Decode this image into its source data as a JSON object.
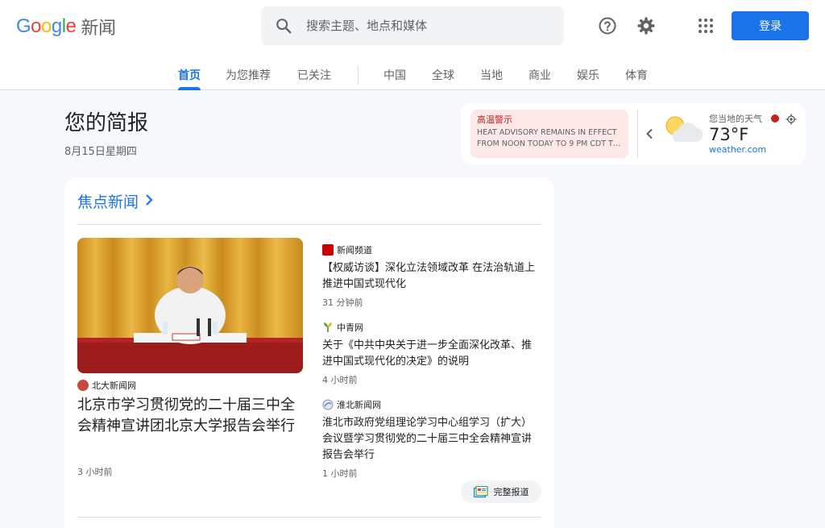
{
  "header": {
    "logo_letters": [
      "G",
      "o",
      "o",
      "g",
      "l",
      "e"
    ],
    "product_name": "新闻",
    "search_placeholder": "搜索主题、地点和媒体",
    "login_label": "登录"
  },
  "tabs": [
    {
      "label": "首页",
      "active": true
    },
    {
      "label": "为您推荐",
      "active": false
    },
    {
      "label": "已关注",
      "active": false
    },
    {
      "label": "中国",
      "active": false
    },
    {
      "label": "全球",
      "active": false
    },
    {
      "label": "当地",
      "active": false
    },
    {
      "label": "商业",
      "active": false
    },
    {
      "label": "娱乐",
      "active": false
    },
    {
      "label": "体育",
      "active": false
    }
  ],
  "briefing": {
    "title": "您的简报",
    "date": "8月15日星期四"
  },
  "weather": {
    "alert_title": "高温警示",
    "alert_line1": "HEAT ADVISORY REMAINS IN EFFECT",
    "alert_line2": "FROM NOON TODAY TO 9 PM CDT THI...",
    "location_label": "您当地的天气",
    "temperature": "73°F",
    "source": "weather.com"
  },
  "top_stories": {
    "heading": "焦点新闻",
    "full_coverage_label": "完整报道",
    "hero": {
      "source": "北大新闻网",
      "title": "北京市学习贯彻党的二十届三中全会精神宣讲团北京大学报告会举行",
      "time": "3 小时前"
    },
    "stories": [
      {
        "source": "新闻频道",
        "title": "【权威访谈】深化立法领域改革 在法治轨道上推进中国式现代化",
        "time": "31 分钟前"
      },
      {
        "source": "中青网",
        "title": "关于《中共中央关于进一步全面深化改革、推进中国式现代化的决定》的说明",
        "time": "4 小时前"
      },
      {
        "source": "淮北新闻网",
        "title": "淮北市政府党组理论学习中心组学习（扩大）会议暨学习贯彻党的二十届三中全会精神宣讲报告会举行",
        "time": "1 小时前"
      }
    ]
  },
  "colors": {
    "accent": "#1a73e8",
    "alert_bg": "#fce8e6",
    "alert_text": "#c5221f",
    "page_bg": "#f6f8fc"
  }
}
